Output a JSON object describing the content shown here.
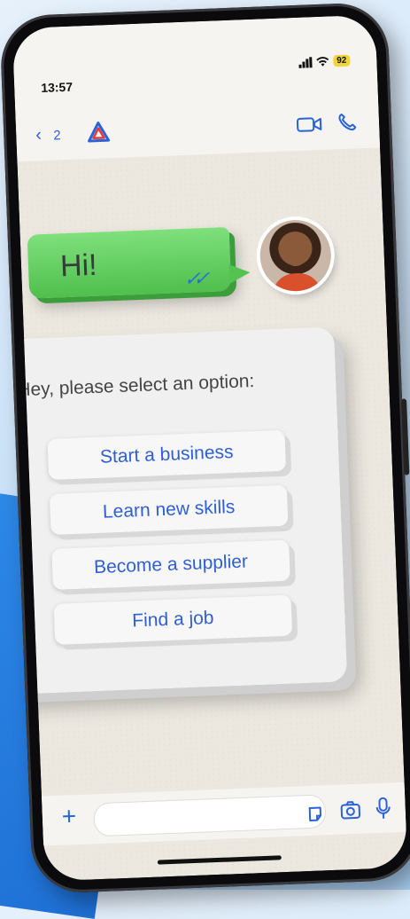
{
  "status": {
    "time": "13:57",
    "battery": "92"
  },
  "header": {
    "back_count": "2"
  },
  "chat": {
    "sent_message": "Hi!",
    "prompt": "Hey, please select an option:",
    "options": [
      "Start a business",
      "Learn new skills",
      "Become a supplier",
      "Find a job"
    ]
  },
  "colors": {
    "accent": "#2a62d8",
    "bubble_green": "#5fcd5c",
    "battery": "#f2d43a"
  }
}
